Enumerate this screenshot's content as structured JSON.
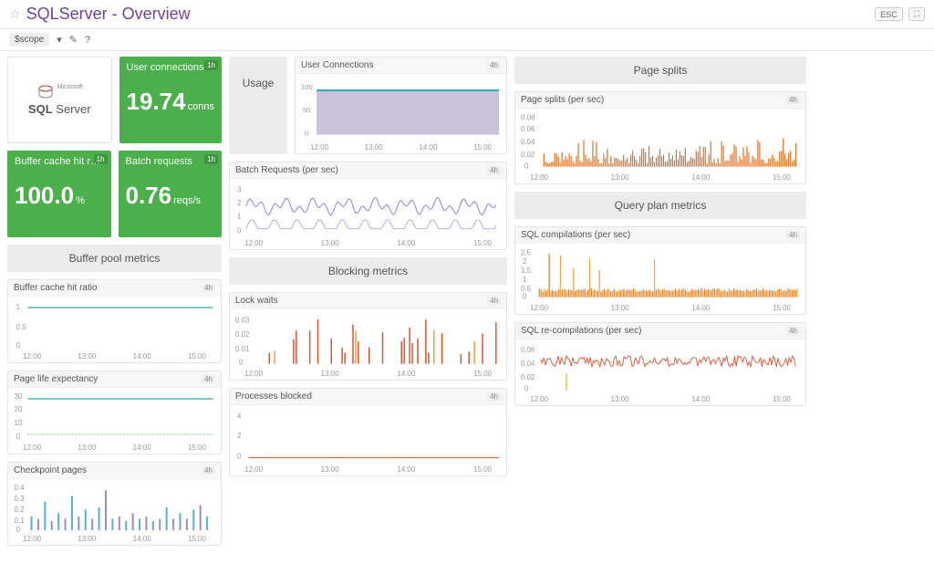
{
  "header": {
    "title": "SQLServer - Overview",
    "esc": "ESC"
  },
  "toolbar": {
    "scope": "$scope"
  },
  "tiles": {
    "logo_brand": "Microsoft",
    "logo_sql": "SQL",
    "logo_server": "Server",
    "user_conn_label": "User connections",
    "user_conn_val": "19.74",
    "user_conn_unit": "conns",
    "buf_label": "Buffer cache hit r…",
    "buf_val": "100.0",
    "buf_unit": "%",
    "batch_label": "Batch requests",
    "batch_val": "0.76",
    "batch_unit": "reqs/s",
    "badge_1h": "1h"
  },
  "sections": {
    "usage": "Usage",
    "buffer": "Buffer pool metrics",
    "blocking": "Blocking metrics",
    "page_splits": "Page splits",
    "query_plan": "Query plan metrics"
  },
  "cards": {
    "user_conn": "User Connections",
    "batch_req": "Batch Requests (per sec)",
    "buf_ratio": "Buffer cache hit ratio",
    "page_life": "Page life expectancy",
    "checkpoint": "Checkpoint pages",
    "lock_waits": "Lock waits",
    "proc_blocked": "Processes blocked",
    "page_splits_ps": "Page splits (per sec)",
    "sql_comp": "SQL compilations (per sec)",
    "sql_recomp": "SQL re-compilations (per sec)",
    "badge_4h": "4h"
  },
  "times": [
    "12:00",
    "13:00",
    "14:00",
    "15:00"
  ],
  "chart_data": {
    "user_connections": {
      "type": "area",
      "ylim": [
        0,
        100
      ],
      "yticks": [
        0,
        50,
        100
      ],
      "baseline": 85,
      "color_fill": "#a89cc8",
      "color_line": "#2aa8a8"
    },
    "batch_requests": {
      "type": "line",
      "ylim": [
        0,
        3
      ],
      "yticks": [
        0,
        1,
        2,
        3
      ],
      "baseline": 1.8,
      "noise": 0.6,
      "color": "#6b6bd6",
      "secondary_baseline": 0.3
    },
    "buffer_ratio": {
      "type": "line",
      "ylim": [
        0,
        1
      ],
      "yticks": [
        0,
        0.5,
        1
      ],
      "value": 1.0,
      "color": "#2aa8a8"
    },
    "page_life": {
      "type": "line",
      "ylim": [
        0,
        30
      ],
      "yticks": [
        0,
        10,
        20,
        30
      ],
      "series": [
        {
          "value": 28,
          "color": "#2aa8a8"
        },
        {
          "value": 3,
          "color": "#8fc98f"
        }
      ]
    },
    "checkpoint": {
      "type": "bar",
      "ylim": [
        0,
        0.4
      ],
      "yticks": [
        0,
        0.1,
        0.2,
        0.3,
        0.4
      ],
      "approx_bars": [
        0.12,
        0.1,
        0.25,
        0.08,
        0.15,
        0.1,
        0.3,
        0.12,
        0.18,
        0.1,
        0.2,
        0.35,
        0.1,
        0.12,
        0.08,
        0.15,
        0.1,
        0.12,
        0.08,
        0.1,
        0.2,
        0.1,
        0.15,
        0.1,
        0.18,
        0.22,
        0.12
      ],
      "colors": [
        "#58b0d8",
        "#9c8cc4"
      ]
    },
    "lock_waits": {
      "type": "bar",
      "ylim": [
        0,
        0.03
      ],
      "yticks": [
        0,
        0.01,
        0.02,
        0.03
      ],
      "color": "#e0502f",
      "color2": "#f0a030"
    },
    "processes_blocked": {
      "type": "line",
      "ylim": [
        0,
        4
      ],
      "yticks": [
        0,
        2,
        4
      ],
      "value": 0,
      "color": "#e0502f"
    },
    "page_splits_per_sec": {
      "type": "bar",
      "ylim": [
        0,
        0.08
      ],
      "yticks": [
        0,
        0.02,
        0.04,
        0.06,
        0.08
      ],
      "color": "#e07020"
    },
    "sql_compilations": {
      "type": "bar",
      "ylim": [
        0,
        2.5
      ],
      "yticks": [
        0,
        0.5,
        1,
        1.5,
        2,
        2.5
      ],
      "color": "#f0a030",
      "color2": "#e07020"
    },
    "sql_recompilations": {
      "type": "line",
      "ylim": [
        0,
        0.06
      ],
      "yticks": [
        0,
        0.02,
        0.04,
        0.06
      ],
      "baseline": 0.04,
      "noise": 0.008,
      "color": "#e0502f"
    }
  }
}
